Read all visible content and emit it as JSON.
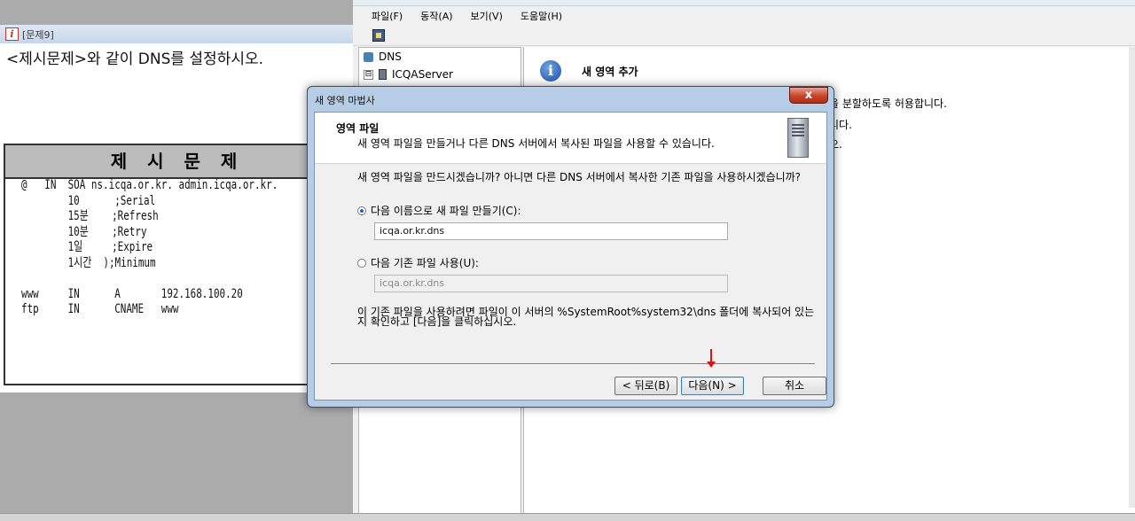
{
  "question_window": {
    "title": "[문제9]",
    "prompt": "<제시문제>와 같이 DNS를 설정하시오.",
    "box_heading": "제 시 문 제",
    "zone_text": "@   IN  SOA ns.icqa.or.kr. admin.icqa.or.kr.\n        10      ;Serial\n        15분    ;Refresh\n        10분    ;Retry\n        1일     ;Expire\n        1시간  );Minimum\n\nwww     IN      A       192.168.100.20\nftp     IN      CNAME   www"
  },
  "dns_manager": {
    "menu": [
      "파일(F)",
      "동작(A)",
      "보기(V)",
      "도움말(H)"
    ],
    "tree": {
      "root": "DNS",
      "server": "ICQAServer",
      "expander": "⊟"
    },
    "right_pane": {
      "title": "새 영역 추가",
      "lines": [
        "을 분할하도록 허용합니다.",
        "니다.",
        "오."
      ]
    }
  },
  "wizard": {
    "window_title": "새 영역 마법사",
    "close_label": "x",
    "header_title": "영역 파일",
    "header_subtitle": "새 영역 파일을 만들거나 다른 DNS 서버에서 복사된 파일을 사용할 수 있습니다.",
    "question": "새 영역 파일을 만드시겠습니까? 아니면 다른 DNS 서버에서 복사한 기존 파일을 사용하시겠습니까?",
    "option_new_label": "다음 이름으로 새 파일 만들기(C):",
    "option_new_value": "icqa.or.kr.dns",
    "option_existing_label": "다음 기존 파일 사용(U):",
    "option_existing_value": "icqa.or.kr.dns",
    "selected_option": "new",
    "note": "이 기존 파일을 사용하려면 파일이 이 서버의 %SystemRoot%system32\\dns 폴더에 복사되어 있는지 확인하고 [다음]을 클릭하십시오.",
    "buttons": {
      "back": "< 뒤로(B)",
      "next": "다음(N) >",
      "cancel": "취소"
    },
    "colors": {
      "arrow": "#e01010",
      "title_bar": "#b7cde6",
      "close": "#c54429"
    }
  }
}
